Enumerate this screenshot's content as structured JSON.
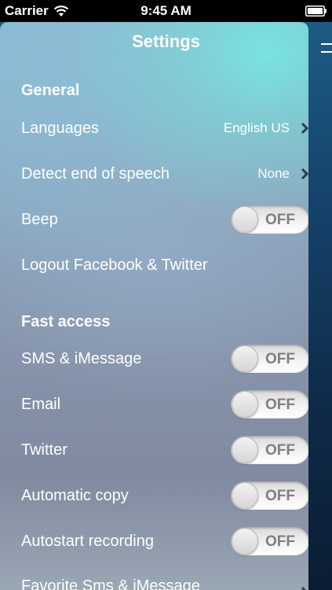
{
  "status_bar": {
    "carrier": "Carrier",
    "time": "9:45 AM"
  },
  "title": "Settings",
  "general": {
    "header": "General",
    "languages": {
      "label": "Languages",
      "value": "English US"
    },
    "detect_end": {
      "label": "Detect end of speech",
      "value": "None"
    },
    "beep": {
      "label": "Beep",
      "state": "OFF"
    },
    "logout": {
      "label": "Logout Facebook & Twitter"
    }
  },
  "fast_access": {
    "header": "Fast access",
    "sms": {
      "label": "SMS & iMessage",
      "state": "OFF"
    },
    "email": {
      "label": "Email",
      "state": "OFF"
    },
    "twitter": {
      "label": "Twitter",
      "state": "OFF"
    },
    "auto_copy": {
      "label": "Automatic copy",
      "state": "OFF"
    },
    "autostart": {
      "label": "Autostart recording",
      "state": "OFF"
    },
    "favorite_sms": {
      "label": "Favorite Sms & iMessage"
    }
  },
  "icons": {
    "wifi": "wifi-icon",
    "battery": "battery-icon",
    "menu": "hamburger-menu-icon",
    "chevron": "chevron-right-icon"
  }
}
